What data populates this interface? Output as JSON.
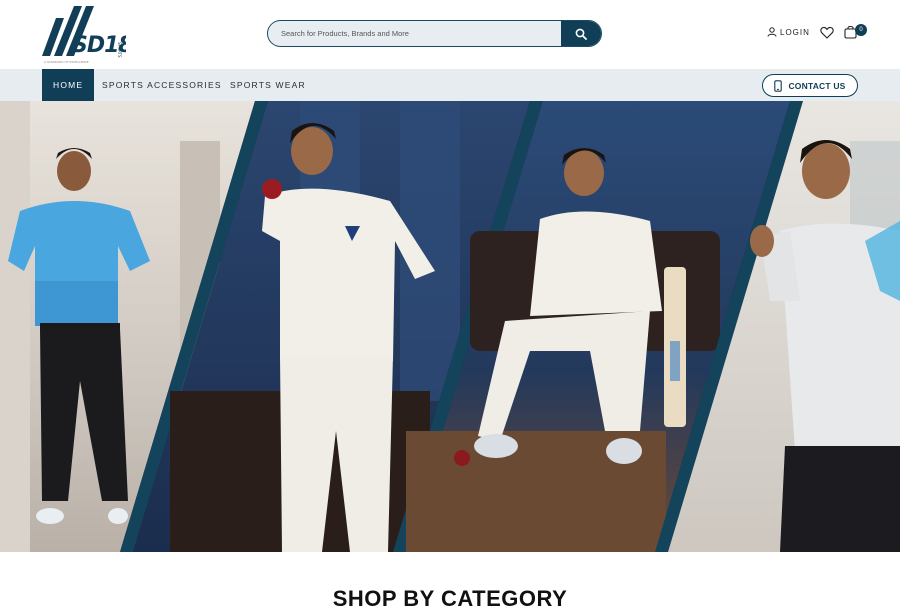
{
  "brand": {
    "name": "SD18",
    "sub": "SPORTS",
    "tagline": "A STANDARD OF EXCELLENCE"
  },
  "search": {
    "placeholder": "Search for Products, Brands and More",
    "icon": "search-icon"
  },
  "header": {
    "login_label": "LOGIN",
    "cart_count": "0"
  },
  "nav": {
    "items": [
      {
        "label": "HOME",
        "active": true
      },
      {
        "label": "SPORTS ACCESSORIES",
        "active": false
      },
      {
        "label": "SPORTS WEAR",
        "active": false
      }
    ],
    "contact_label": "CONTACT US"
  },
  "hero": {
    "panels": [
      "cricketer-hexagon-jersey",
      "cricketer-holding-ball",
      "cricketer-seated-with-bat",
      "cricketer-pointing"
    ]
  },
  "section": {
    "title": "SHOP BY CATEGORY"
  },
  "colors": {
    "brand_navy": "#0f3e56",
    "nav_bg": "#e6ecf0",
    "search_bg": "#e7edf1"
  }
}
